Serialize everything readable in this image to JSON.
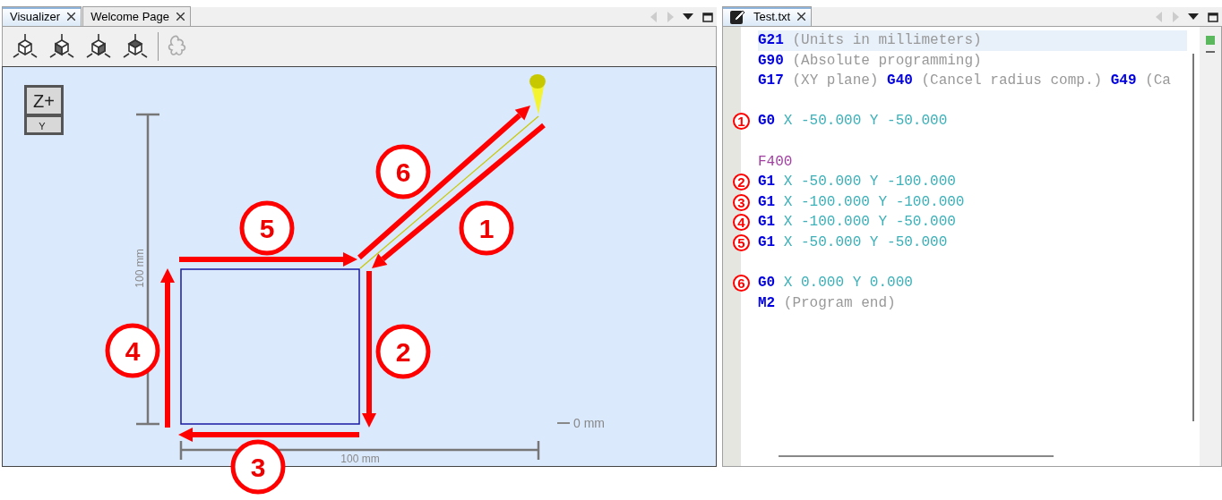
{
  "visualizer_panel": {
    "tabs": [
      {
        "label": "Visualizer",
        "selected": true
      },
      {
        "label": "Welcome Page",
        "selected": false
      }
    ],
    "canvas": {
      "view_cube": {
        "top_face": "Z+",
        "front_face": "Y"
      },
      "vertical_dimension": "100 mm",
      "horizontal_dimension": "100 mm",
      "origin_label": "0 mm"
    }
  },
  "editor_panel": {
    "tab": {
      "label": "Test.txt",
      "selected": true
    },
    "lines": [
      {
        "kind": "code",
        "selected": true,
        "tokens": [
          {
            "kind": "command",
            "text": "G21"
          },
          {
            "kind": "comment",
            "text": "(Units in millimeters)"
          }
        ]
      },
      {
        "kind": "code",
        "selected": false,
        "tokens": [
          {
            "kind": "command",
            "text": "G90"
          },
          {
            "kind": "comment",
            "text": "(Absolute programming)"
          }
        ]
      },
      {
        "kind": "code",
        "selected": false,
        "tokens": [
          {
            "kind": "command",
            "text": "G17"
          },
          {
            "kind": "comment",
            "text": "(XY plane)"
          },
          {
            "kind": "command",
            "text": "G40"
          },
          {
            "kind": "comment",
            "text": "(Cancel radius comp.)"
          },
          {
            "kind": "command",
            "text": "G49"
          },
          {
            "kind": "comment",
            "text": "(Ca"
          }
        ]
      },
      {
        "kind": "blank"
      },
      {
        "kind": "code",
        "selected": false,
        "marker": "1",
        "tokens": [
          {
            "kind": "command",
            "text": "G0"
          },
          {
            "kind": "coordinate",
            "text": "X -50.000 Y -50.000"
          }
        ]
      },
      {
        "kind": "blank"
      },
      {
        "kind": "code",
        "selected": false,
        "tokens": [
          {
            "kind": "feed",
            "text": "F400"
          }
        ]
      },
      {
        "kind": "code",
        "selected": false,
        "marker": "2",
        "tokens": [
          {
            "kind": "command",
            "text": "G1"
          },
          {
            "kind": "coordinate",
            "text": "X -50.000 Y -100.000"
          }
        ]
      },
      {
        "kind": "code",
        "selected": false,
        "marker": "3",
        "tokens": [
          {
            "kind": "command",
            "text": "G1"
          },
          {
            "kind": "coordinate",
            "text": "X -100.000 Y -100.000"
          }
        ]
      },
      {
        "kind": "code",
        "selected": false,
        "marker": "4",
        "tokens": [
          {
            "kind": "command",
            "text": "G1"
          },
          {
            "kind": "coordinate",
            "text": "X -100.000 Y -50.000"
          }
        ]
      },
      {
        "kind": "code",
        "selected": false,
        "marker": "5",
        "tokens": [
          {
            "kind": "command",
            "text": "G1"
          },
          {
            "kind": "coordinate",
            "text": "X -50.000 Y -50.000"
          }
        ]
      },
      {
        "kind": "blank"
      },
      {
        "kind": "code",
        "selected": false,
        "marker": "6",
        "tokens": [
          {
            "kind": "command",
            "text": "G0"
          },
          {
            "kind": "coordinate",
            "text": "X 0.000 Y 0.000"
          }
        ]
      },
      {
        "kind": "code",
        "selected": false,
        "tokens": [
          {
            "kind": "command",
            "text": "M2"
          },
          {
            "kind": "comment",
            "text": "(Program end)"
          }
        ]
      }
    ]
  },
  "path_annotations": [
    "1",
    "2",
    "3",
    "4",
    "5",
    "6"
  ]
}
